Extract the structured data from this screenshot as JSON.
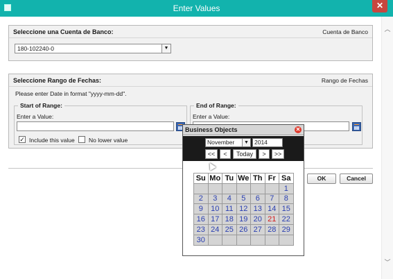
{
  "window": {
    "title": "Enter Values",
    "close_glyph": "✕"
  },
  "bank_panel": {
    "title": "Seleccione una Cuenta de Banco:",
    "hint": "Cuenta de Banco",
    "selected_value": "180-102240-0"
  },
  "date_panel": {
    "title": "Seleccione Rango de Fechas:",
    "hint": "Rango de Fechas",
    "instruction": "Please enter Date in format \"yyyy-mm-dd\".",
    "start": {
      "legend": "Start of Range:",
      "label": "Enter a Value:",
      "value": "",
      "include_label": "Include this value",
      "include_checked": true,
      "nolower_label": "No lower value",
      "nolower_checked": false
    },
    "end": {
      "legend": "End of Range:",
      "label": "Enter a Value:",
      "value": ""
    }
  },
  "buttons": {
    "ok": "OK",
    "cancel": "Cancel"
  },
  "calendar": {
    "title": "Business Objects",
    "month": "November",
    "year": "2014",
    "nav": {
      "first": "<<",
      "prev": "<",
      "today": "Today",
      "next": ">",
      "last": ">>"
    },
    "weekdays": [
      "Su",
      "Mo",
      "Tu",
      "We",
      "Th",
      "Fr",
      "Sa"
    ],
    "weeks": [
      [
        "",
        "",
        "",
        "",
        "",
        "",
        "1"
      ],
      [
        "2",
        "3",
        "4",
        "5",
        "6",
        "7",
        "8"
      ],
      [
        "9",
        "10",
        "11",
        "12",
        "13",
        "14",
        "15"
      ],
      [
        "16",
        "17",
        "18",
        "19",
        "20",
        "21",
        "22"
      ],
      [
        "23",
        "24",
        "25",
        "26",
        "27",
        "28",
        "29"
      ],
      [
        "30",
        "",
        "",
        "",
        "",
        "",
        ""
      ]
    ],
    "highlighted_day": "21",
    "colors": {
      "day": "#2a3fb0",
      "highlight": "#d51b1b",
      "nav_bg": "#1a1a1a"
    }
  },
  "icons": {
    "scroll_up": "︿",
    "scroll_down": "﹀",
    "checkmark": "✓",
    "dropdown": "▼"
  },
  "accent_color": "#12b3ad"
}
